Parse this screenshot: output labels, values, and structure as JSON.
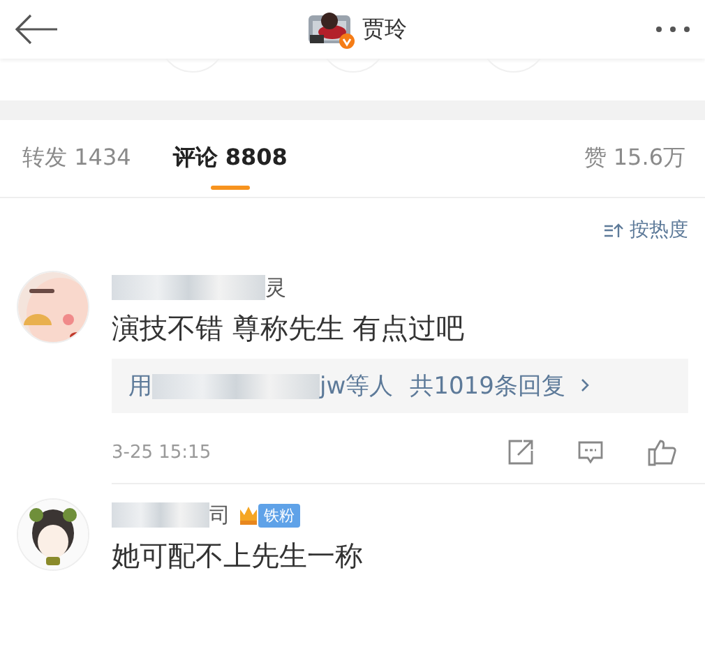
{
  "header": {
    "title": "贾玲",
    "verified": true
  },
  "tabs": [
    {
      "label": "转发",
      "count": "1434",
      "selected": false
    },
    {
      "label": "评论",
      "count": "8808",
      "selected": true
    }
  ],
  "likes": {
    "label": "赞",
    "count": "15.6万"
  },
  "sort": {
    "label": "按热度"
  },
  "comments": [
    {
      "username": "灵",
      "text": "演技不错 尊称先生 有点过吧",
      "replies": {
        "prefix": "用",
        "suffix": "jw等人",
        "count": "共1019条回复"
      },
      "time": "3-25 15:15"
    },
    {
      "username": "司",
      "badge": "铁粉",
      "text": "她可配不上先生一称"
    }
  ]
}
